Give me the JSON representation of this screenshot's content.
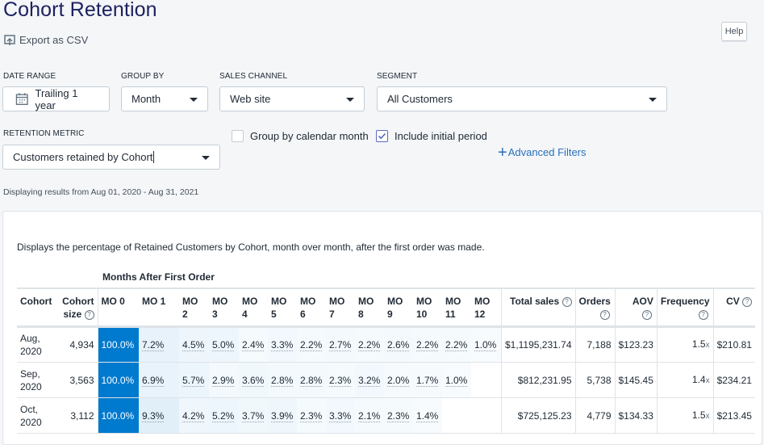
{
  "page": {
    "title": "Cohort Retention",
    "export_label": "Export as CSV",
    "help_label": "Help"
  },
  "filters": {
    "date_range": {
      "label": "DATE RANGE",
      "value": "Trailing 1 year"
    },
    "group_by": {
      "label": "GROUP BY",
      "value": "Month"
    },
    "sales_channel": {
      "label": "SALES CHANNEL",
      "value": "Web site"
    },
    "segment": {
      "label": "SEGMENT",
      "value": "All Customers"
    },
    "retention_metric": {
      "label": "RETENTION METRIC",
      "value": "Customers retained by Cohort"
    },
    "group_by_calendar_month": {
      "label": "Group by calendar month",
      "checked": false
    },
    "include_initial_period": {
      "label": "Include initial period",
      "checked": true
    },
    "advanced_filters_label": "Advanced Filters"
  },
  "range_text": "Displaying results from Aug 01, 2020 - Aug 31, 2021",
  "report": {
    "description": "Displays the percentage of Retained Customers by Cohort, month over month, after the first order was made.",
    "months_header": "Months After First Order",
    "columns": {
      "cohort": "Cohort",
      "cohort_size_1": "Cohort",
      "cohort_size_2": "size",
      "months": [
        [
          "MO 0",
          ""
        ],
        [
          "MO 1",
          ""
        ],
        [
          "MO",
          "2"
        ],
        [
          "MO",
          "3"
        ],
        [
          "MO",
          "4"
        ],
        [
          "MO",
          "5"
        ],
        [
          "MO",
          "6"
        ],
        [
          "MO",
          "7"
        ],
        [
          "MO",
          "8"
        ],
        [
          "MO",
          "9"
        ],
        [
          "MO",
          "10"
        ],
        [
          "MO",
          "11"
        ],
        [
          "MO",
          "12"
        ]
      ],
      "total_sales": "Total sales",
      "orders": "Orders",
      "aov": "AOV",
      "frequency": "Frequency",
      "cv": "CV"
    },
    "rows": [
      {
        "cohort": [
          "Aug,",
          "2020"
        ],
        "size": "4,934",
        "retention": [
          "100.0%",
          "7.2%",
          "4.5%",
          "5.0%",
          "2.4%",
          "3.3%",
          "2.2%",
          "2.7%",
          "2.2%",
          "2.6%",
          "2.2%",
          "2.2%",
          "1.0%"
        ],
        "total_sales": "$1,1195,231.74",
        "orders": "7,188",
        "aov": "$123.23",
        "frequency": "1.5",
        "cv": "$210.81"
      },
      {
        "cohort": [
          "Sep,",
          "2020"
        ],
        "size": "3,563",
        "retention": [
          "100.0%",
          "6.9%",
          "5.7%",
          "2.9%",
          "3.6%",
          "2.8%",
          "2.8%",
          "2.3%",
          "3.2%",
          "2.0%",
          "1.7%",
          "1.0%",
          ""
        ],
        "total_sales": "$812,231.95",
        "orders": "5,738",
        "aov": "$145.45",
        "frequency": "1.4",
        "cv": "$234.21"
      },
      {
        "cohort": [
          "Oct,",
          "2020"
        ],
        "size": "3,112",
        "retention": [
          "100.0%",
          "9.3%",
          "4.2%",
          "5.2%",
          "3.7%",
          "3.9%",
          "2.3%",
          "3.3%",
          "2.1%",
          "2.3%",
          "1.4%",
          "",
          ""
        ],
        "total_sales": "$725,125.23",
        "orders": "4,779",
        "aov": "$134.33",
        "frequency": "1.5",
        "cv": "$213.45"
      }
    ],
    "frequency_suffix": "x",
    "colors": {
      "full": "#007ace",
      "full_text": "#ffffff"
    }
  }
}
